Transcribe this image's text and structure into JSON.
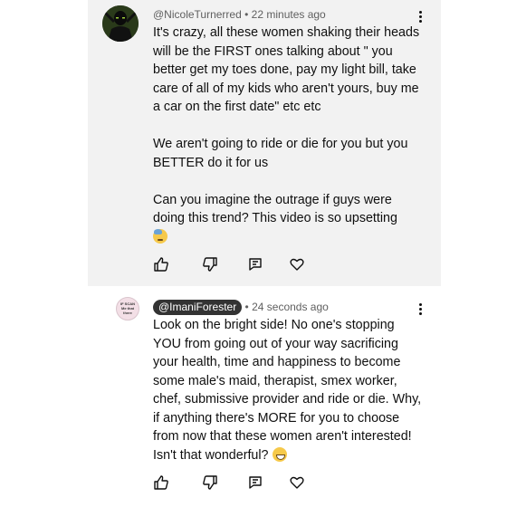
{
  "comments": [
    {
      "author": "@NicoleTurnerred",
      "time": "22 minutes ago",
      "text": "It's crazy, all these women shaking their heads will be the FIRST ones talking about \" you better get my toes done, pay my light bill, take care of all of my kids who aren't yours, buy me a car on the first date\" etc etc\n\nWe aren't going to ride or die for you but you BETTER do it for us\n\nCan you imagine the outrage if guys were doing this trend?  This video is so upsetting",
      "emoji": "sad-sweat-emoji",
      "avatar_icon": "dark-figure-avatar"
    },
    {
      "author": "@ImaniForester",
      "time": "24 seconds ago",
      "text": "Look on the bright side! No one's stopping YOU from going out of your way sacrificing your health, time and happiness to become some male's maid, therapist, smex worker, chef, submissive provider and ride or die. Why, if anything there's MORE for you to choose from now that these women aren't interested! Isn't that wonderful?",
      "emoji": "grinning-emoji",
      "avatar_text": "IF SCAN\nMe that\nthere"
    }
  ],
  "actions": [
    "like-icon",
    "dislike-icon",
    "reply-icon",
    "heart-icon"
  ],
  "colors": {
    "highlight_bg": "#f2f2f2",
    "chip_bg": "#333333",
    "meta_text": "#606060"
  }
}
